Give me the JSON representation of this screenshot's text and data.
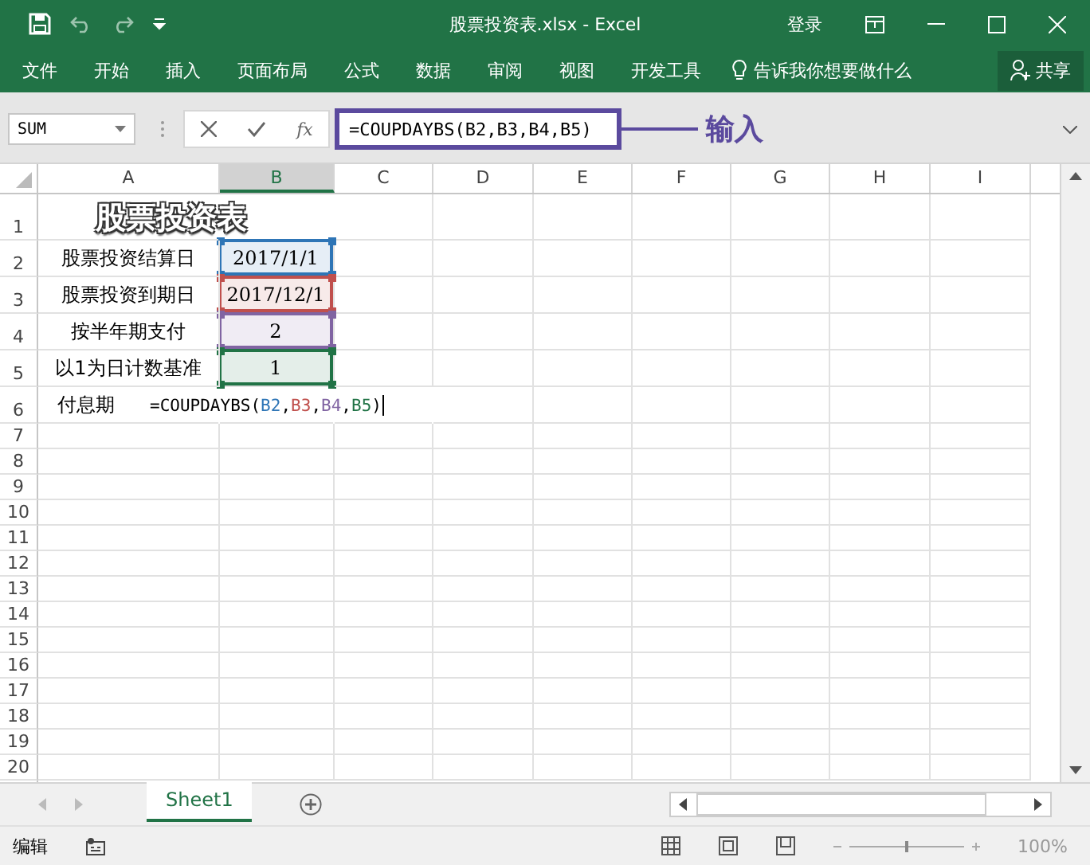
{
  "title_bar": {
    "title": "股票投资表.xlsx  -  Excel",
    "login": "登录"
  },
  "ribbon": {
    "tabs": [
      {
        "label": "文件",
        "selected": false
      },
      {
        "label": "开始",
        "selected": false
      },
      {
        "label": "插入",
        "selected": false
      },
      {
        "label": "页面布局",
        "selected": false
      },
      {
        "label": "公式",
        "selected": false
      },
      {
        "label": "数据",
        "selected": false
      },
      {
        "label": "审阅",
        "selected": false
      },
      {
        "label": "视图",
        "selected": false
      },
      {
        "label": "开发工具",
        "selected": false
      }
    ],
    "tell_me": "告诉我你想要做什么",
    "share": "共享"
  },
  "formula_bar": {
    "name_box": "SUM",
    "fx": "fx",
    "formula": "=COUPDAYBS(B2,B3,B4,B5)",
    "callout": "输入"
  },
  "columns": [
    {
      "label": "A",
      "selected": false
    },
    {
      "label": "B",
      "selected": true
    },
    {
      "label": "C",
      "selected": false
    },
    {
      "label": "D",
      "selected": false
    },
    {
      "label": "E",
      "selected": false
    },
    {
      "label": "F",
      "selected": false
    },
    {
      "label": "G",
      "selected": false
    },
    {
      "label": "H",
      "selected": false
    },
    {
      "label": "I",
      "selected": false
    }
  ],
  "rows": [
    {
      "number": "1",
      "kind": "title",
      "a": "股票投资表"
    },
    {
      "number": "2",
      "kind": "param",
      "a": "股票投资结算日",
      "b": "2017/1/1",
      "color": "#2e75b6"
    },
    {
      "number": "3",
      "kind": "param",
      "a": "股票投资到期日",
      "b": "2017/12/1",
      "color": "#c0504d"
    },
    {
      "number": "4",
      "kind": "param",
      "a": "按半年期支付",
      "b": "2",
      "color": "#8064a2"
    },
    {
      "number": "5",
      "kind": "param",
      "a": "以1为日计数基准",
      "b": "1",
      "color": "#217346"
    },
    {
      "number": "6",
      "kind": "formula",
      "a": "付息期",
      "prefix": "=COUPDAYBS(",
      "refs": [
        {
          "text": "B2",
          "color": "#2e75b6",
          "sep": ","
        },
        {
          "text": "B3",
          "color": "#c0504d",
          "sep": ","
        },
        {
          "text": "B4",
          "color": "#8064a2",
          "sep": ","
        },
        {
          "text": "B5",
          "color": "#217346",
          "sep": ")"
        }
      ]
    },
    {
      "number": "7",
      "kind": "empty"
    },
    {
      "number": "8",
      "kind": "empty"
    },
    {
      "number": "9",
      "kind": "empty"
    },
    {
      "number": "10",
      "kind": "empty"
    },
    {
      "number": "11",
      "kind": "empty"
    },
    {
      "number": "12",
      "kind": "empty"
    },
    {
      "number": "13",
      "kind": "empty"
    },
    {
      "number": "14",
      "kind": "empty"
    },
    {
      "number": "15",
      "kind": "empty"
    },
    {
      "number": "16",
      "kind": "empty"
    },
    {
      "number": "17",
      "kind": "empty"
    },
    {
      "number": "18",
      "kind": "empty"
    },
    {
      "number": "19",
      "kind": "empty"
    },
    {
      "number": "20",
      "kind": "empty"
    }
  ],
  "sheets": [
    {
      "label": "Sheet1",
      "selected": true
    }
  ],
  "status_bar": {
    "mode": "编辑",
    "zoom": "100%",
    "zoom_slider": {
      "level": 0.5
    }
  }
}
